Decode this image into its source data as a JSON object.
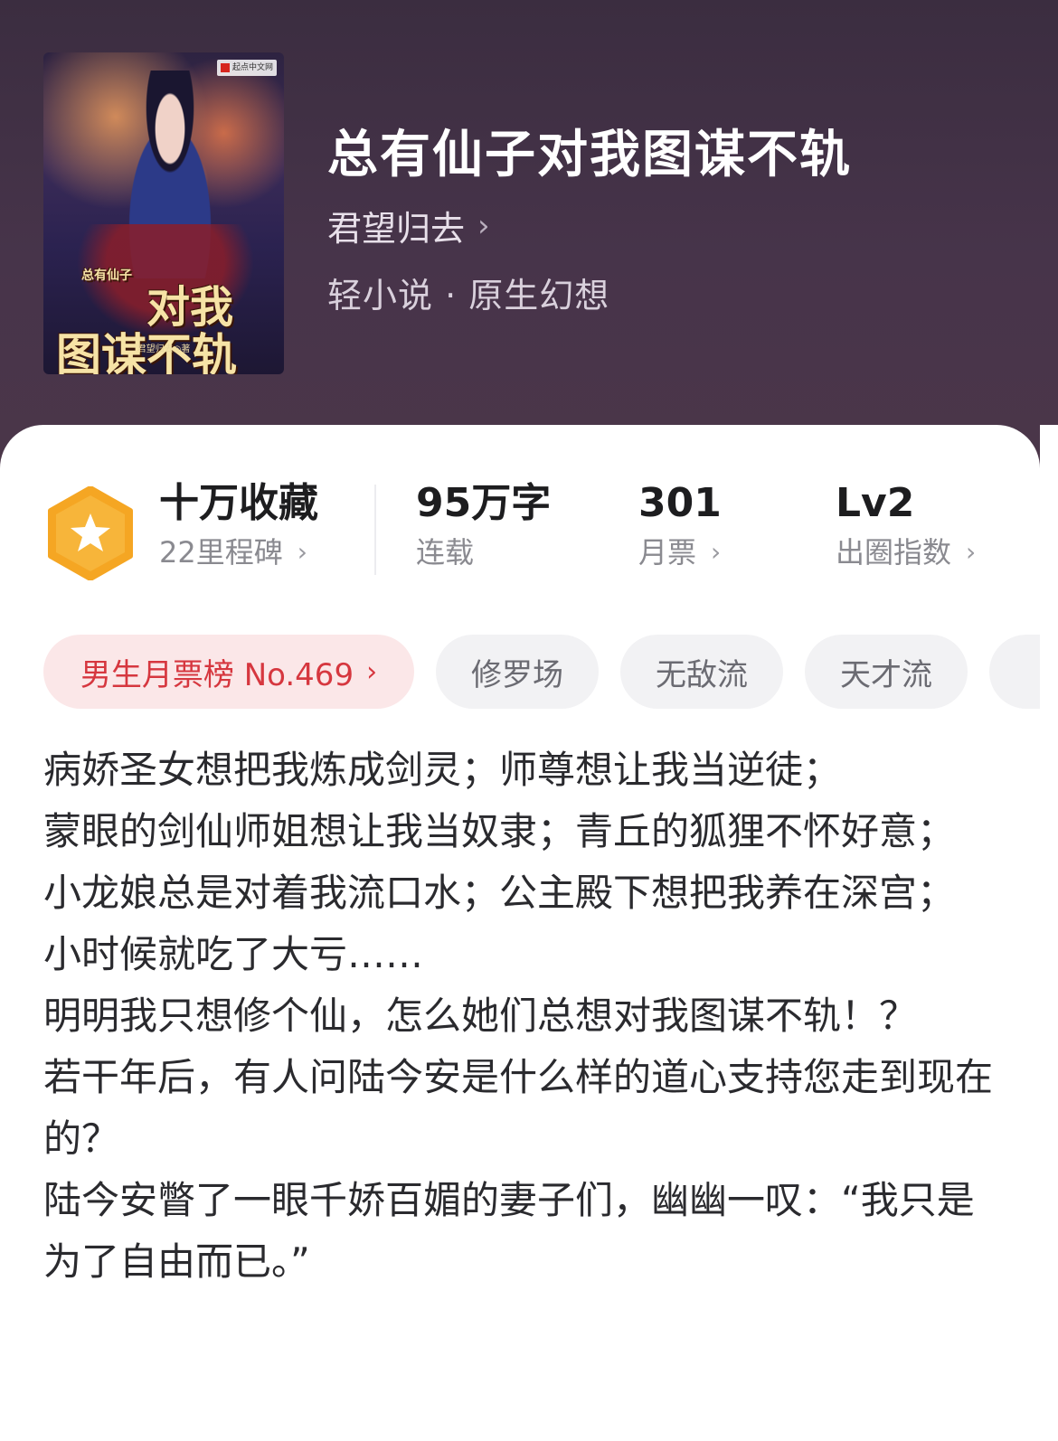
{
  "book": {
    "title": "总有仙子对我图谋不轨",
    "author": "君望归去",
    "genre": "轻小说 · 原生幻想"
  },
  "cover": {
    "publisher": "起点中文网",
    "title_small": "总有仙子",
    "title_line1": "对我",
    "title_line2": "图谋不轨",
    "author_line": "君望归去◎著"
  },
  "icons": {
    "chevron": "chevron-right-icon",
    "badge": "star-badge-icon"
  },
  "stats": {
    "collection": {
      "value": "十万收藏",
      "label": "22里程碑"
    },
    "words": {
      "value": "95万字",
      "label": "连载"
    },
    "tickets": {
      "value": "301",
      "label": "月票"
    },
    "level": {
      "value": "Lv2",
      "label": "出圈指数"
    }
  },
  "chips": {
    "rank": "男生月票榜 No.469",
    "tags": [
      "修罗场",
      "无敌流",
      "天才流"
    ]
  },
  "synopsis": [
    "病娇圣女想把我炼成剑灵；师尊想让我当逆徒；",
    "蒙眼的剑仙师姐想让我当奴隶；青丘的狐狸不怀好意；",
    "小龙娘总是对着我流口水；公主殿下想把我养在深宫；",
    "小时候就吃了大亏……",
    "明明我只想修个仙，怎么她们总想对我图谋不轨！？",
    "若干年后，有人问陆今安是什么样的道心支持您走到现在的？",
    "陆今安瞥了一眼千娇百媚的妻子们，幽幽一叹：“我只是为了自由而已。”"
  ],
  "colors": {
    "header_bg": "#3b2d40",
    "rank_red": "#d6373f",
    "badge_orange": "#f5a623"
  }
}
